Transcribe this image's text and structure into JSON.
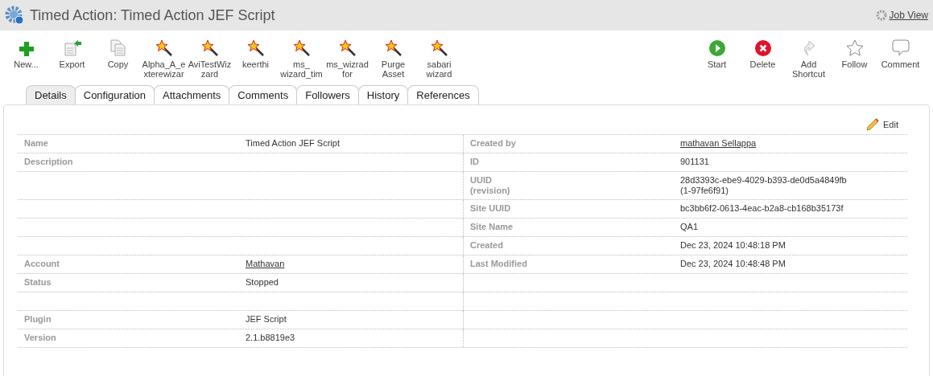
{
  "header": {
    "title": "Timed Action: Timed Action JEF Script",
    "link": "Job View"
  },
  "toolbar_left": [
    {
      "kind": "new",
      "label": "New..."
    },
    {
      "kind": "export",
      "label": "Export"
    },
    {
      "kind": "copy",
      "label": "Copy"
    },
    {
      "kind": "wizard",
      "label": "Alpha_A_e xterewizar"
    },
    {
      "kind": "wizard",
      "label": "AviTestWiz zard"
    },
    {
      "kind": "wizard",
      "label": "keerthi"
    },
    {
      "kind": "wizard",
      "label": "ms_ wizard_tim"
    },
    {
      "kind": "wizard",
      "label": "ms_wizrad for"
    },
    {
      "kind": "wizard",
      "label": "Purge Asset"
    },
    {
      "kind": "wizard",
      "label": "sabari wizard"
    }
  ],
  "toolbar_right": [
    {
      "kind": "start",
      "label": "Start"
    },
    {
      "kind": "delete",
      "label": "Delete"
    },
    {
      "kind": "shortcut",
      "label": "Add Shortcut"
    },
    {
      "kind": "follow",
      "label": "Follow"
    },
    {
      "kind": "comment",
      "label": "Comment"
    }
  ],
  "tabs": [
    {
      "label": "Details",
      "selected": true
    },
    {
      "label": "Configuration",
      "selected": false
    },
    {
      "label": "Attachments",
      "selected": false
    },
    {
      "label": "Comments",
      "selected": false
    },
    {
      "label": "Followers",
      "selected": false
    },
    {
      "label": "History",
      "selected": false
    },
    {
      "label": "References",
      "selected": false
    }
  ],
  "edit_label": "Edit",
  "rows": [
    {
      "left": {
        "label": "Name",
        "value": "Timed Action JEF Script",
        "link": false
      },
      "right": {
        "label": "Created by",
        "value": "mathavan Sellappa",
        "link": true
      }
    },
    {
      "left": {
        "label": "Description"
      },
      "right": {
        "label": "ID",
        "value": "901131",
        "link": false
      }
    },
    {
      "right": {
        "label": "UUID\n(revision)",
        "value": "28d3393c-ebe9-4029-b393-de0d5a4849fb\n(1-97fe6f91)",
        "link": false
      }
    },
    {
      "right": {
        "label": "Site UUID",
        "value": "bc3bb6f2-0613-4eac-b2a8-cb168b35173f",
        "link": false
      }
    },
    {
      "right": {
        "label": "Site Name",
        "value": "QA1",
        "link": false
      }
    },
    {
      "right": {
        "label": "Created",
        "value": "Dec 23, 2024 10:48:18 PM",
        "link": false
      }
    },
    {
      "left": {
        "label": "Account",
        "value": "Mathavan",
        "link": true
      },
      "right": {
        "label": "Last Modified",
        "value": "Dec 23, 2024 10:48:48 PM",
        "link": false
      }
    },
    {
      "left": {
        "label": "Status",
        "value": "Stopped",
        "link": false
      }
    },
    {},
    {
      "left": {
        "label": "Plugin",
        "value": "JEF Script",
        "link": false
      }
    },
    {
      "left": {
        "label": "Version",
        "value": "2.1.b8819e3",
        "link": false
      }
    }
  ]
}
